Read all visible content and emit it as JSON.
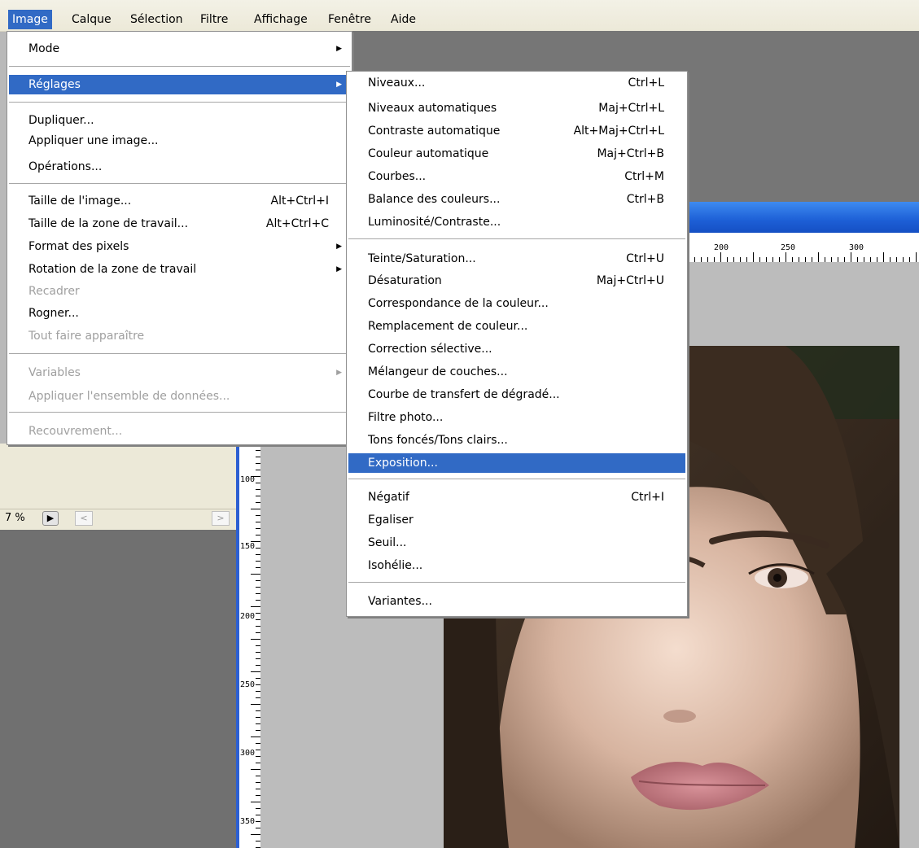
{
  "menubar": {
    "items": [
      {
        "id": "image",
        "label": "Image",
        "active": true
      },
      {
        "id": "calque",
        "label": "Calque"
      },
      {
        "id": "selection",
        "label": "Sélection"
      },
      {
        "id": "filtre",
        "label": "Filtre"
      },
      {
        "id": "affichage",
        "label": "Affichage"
      },
      {
        "id": "fenetre",
        "label": "Fenêtre"
      },
      {
        "id": "aide",
        "label": "Aide"
      }
    ]
  },
  "image_menu": {
    "mode": "Mode",
    "reglages": "Réglages",
    "dupliquer": "Dupliquer...",
    "appliquer_image": "Appliquer une image...",
    "operations": "Opérations...",
    "taille_image": {
      "label": "Taille de l'image...",
      "shortcut": "Alt+Ctrl+I"
    },
    "taille_zone": {
      "label": "Taille de la zone de travail...",
      "shortcut": "Alt+Ctrl+C"
    },
    "format_pixels": "Format des pixels",
    "rotation": "Rotation de la zone de travail",
    "recadrer": "Recadrer",
    "rogner": "Rogner...",
    "tout_faire": "Tout faire apparaître",
    "variables": "Variables",
    "appliquer_ensemble": "Appliquer l'ensemble de données...",
    "recouvrement": "Recouvrement..."
  },
  "reglages_menu": {
    "niveaux": {
      "label": "Niveaux...",
      "shortcut": "Ctrl+L"
    },
    "niveaux_auto": {
      "label": "Niveaux automatiques",
      "shortcut": "Maj+Ctrl+L"
    },
    "contraste_auto": {
      "label": "Contraste automatique",
      "shortcut": "Alt+Maj+Ctrl+L"
    },
    "couleur_auto": {
      "label": "Couleur automatique",
      "shortcut": "Maj+Ctrl+B"
    },
    "courbes": {
      "label": "Courbes...",
      "shortcut": "Ctrl+M"
    },
    "balance": {
      "label": "Balance des couleurs...",
      "shortcut": "Ctrl+B"
    },
    "luminosite": {
      "label": "Luminosité/Contraste..."
    },
    "teinte": {
      "label": "Teinte/Saturation...",
      "shortcut": "Ctrl+U"
    },
    "desaturation": {
      "label": "Désaturation",
      "shortcut": "Maj+Ctrl+U"
    },
    "correspondance": {
      "label": "Correspondance de la couleur..."
    },
    "remplacement": {
      "label": "Remplacement de couleur..."
    },
    "correction": {
      "label": "Correction sélective..."
    },
    "melangeur": {
      "label": "Mélangeur de couches..."
    },
    "courbe_transfert": {
      "label": "Courbe de transfert de dégradé..."
    },
    "filtre_photo": {
      "label": "Filtre photo..."
    },
    "tons": {
      "label": "Tons foncés/Tons clairs..."
    },
    "exposition": {
      "label": "Exposition..."
    },
    "negatif": {
      "label": "Négatif",
      "shortcut": "Ctrl+I"
    },
    "egaliser": {
      "label": "Egaliser"
    },
    "seuil": {
      "label": "Seuil..."
    },
    "isohelie": {
      "label": "Isohélie..."
    },
    "variantes": {
      "label": "Variantes..."
    }
  },
  "status": {
    "zoom": "7 %"
  },
  "ruler_h": [
    "200",
    "250",
    "300"
  ],
  "ruler_v": [
    "100",
    "150",
    "200",
    "250",
    "300",
    "350"
  ],
  "colors": {
    "highlight": "#316ac5",
    "menubar": "#ece9d8",
    "title_bar": "#1d5fd6"
  }
}
